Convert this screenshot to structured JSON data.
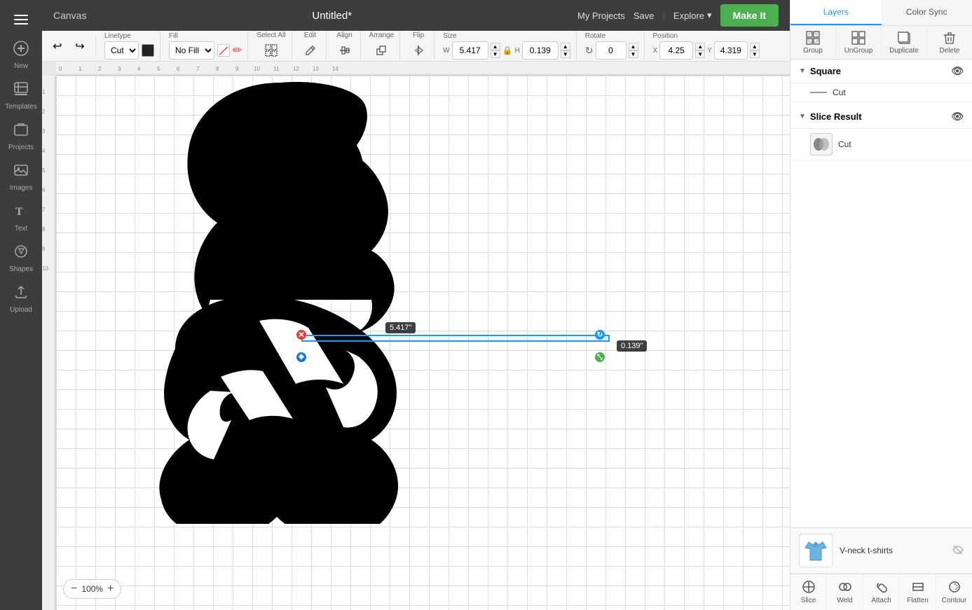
{
  "app": {
    "title": "Canvas",
    "document_title": "Untitled*"
  },
  "topbar": {
    "my_projects": "My Projects",
    "save": "Save",
    "explore": "Explore",
    "make_it": "Make It"
  },
  "toolbar": {
    "undo_label": "↩",
    "redo_label": "↪",
    "linetype_label": "Linetype",
    "linetype_value": "Cut",
    "fill_label": "Fill",
    "fill_value": "No Fill",
    "select_all_label": "Select All",
    "edit_label": "Edit",
    "align_label": "Align",
    "arrange_label": "Arrange",
    "flip_label": "Flip",
    "size_label": "Size",
    "size_w_label": "W",
    "size_w_value": "5.417",
    "size_h_label": "H",
    "size_h_value": "0.139",
    "rotate_label": "Rotate",
    "rotate_value": "0",
    "position_label": "Position",
    "position_x_label": "X",
    "position_x_value": "4.25",
    "position_y_label": "Y",
    "position_y_value": "4.319"
  },
  "layers": {
    "tab_layers": "Layers",
    "tab_color_sync": "Color Sync",
    "group_btn": "Group",
    "ungroup_btn": "UnGroup",
    "duplicate_btn": "Duplicate",
    "delete_btn": "Delete",
    "square_section": "Square",
    "square_cut": "Cut",
    "slice_result_section": "Slice Result",
    "slice_result_cut": "Cut"
  },
  "canvas": {
    "zoom": "100%",
    "zoom_in": "+",
    "zoom_out": "−",
    "width_tooltip": "5.417\"",
    "height_tooltip": "0.139\""
  },
  "preview": {
    "label": "V-neck t-shirts"
  },
  "bottom_actions": [
    {
      "id": "slice",
      "label": "Slice",
      "icon": "◈"
    },
    {
      "id": "weld",
      "label": "Weld",
      "icon": "⊕"
    },
    {
      "id": "attach",
      "label": "Attach",
      "icon": "📎"
    },
    {
      "id": "flatten",
      "label": "Flatten",
      "icon": "⊞"
    },
    {
      "id": "contour",
      "label": "Contour",
      "icon": "◇"
    }
  ],
  "ruler": {
    "top_marks": [
      "0",
      "1",
      "2",
      "3",
      "4",
      "5",
      "6",
      "7",
      "8",
      "9",
      "10",
      "11",
      "12",
      "13",
      "14"
    ],
    "left_marks": [
      "1",
      "2",
      "3",
      "4",
      "5",
      "6",
      "7",
      "8",
      "9",
      "10"
    ]
  }
}
